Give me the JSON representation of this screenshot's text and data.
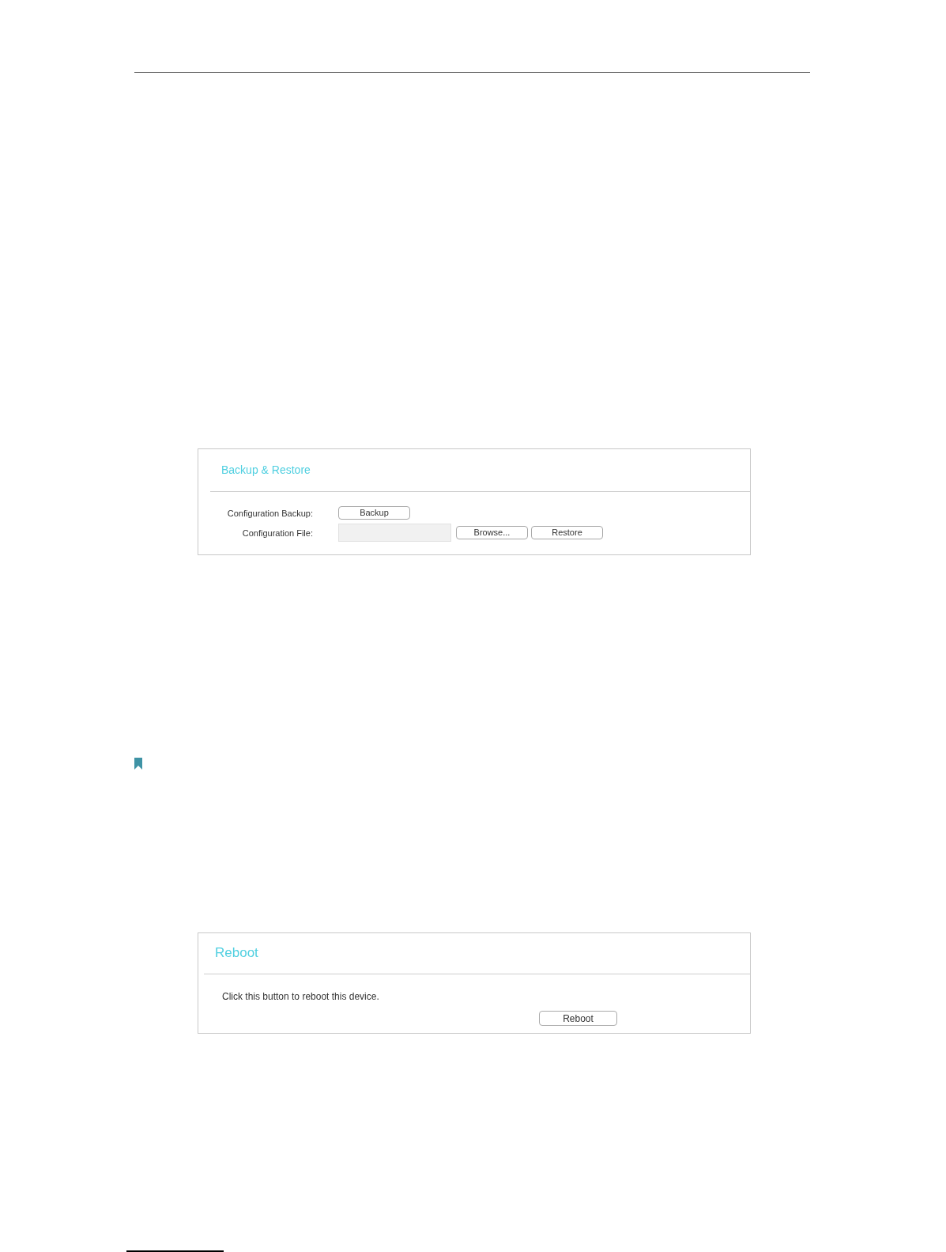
{
  "panels": [
    {
      "kind": "form",
      "title": "Backup & Restore",
      "rows": [
        {
          "kind": "action",
          "label": "Configuration Backup:",
          "buttons": [
            "Backup"
          ]
        },
        {
          "kind": "file",
          "label": "Configuration File:",
          "buttons": [
            "Browse...",
            "Restore"
          ]
        }
      ]
    },
    {
      "kind": "message",
      "title": "Reboot",
      "text": "Click this button to reboot this device.",
      "buttons": [
        "Reboot"
      ]
    }
  ]
}
